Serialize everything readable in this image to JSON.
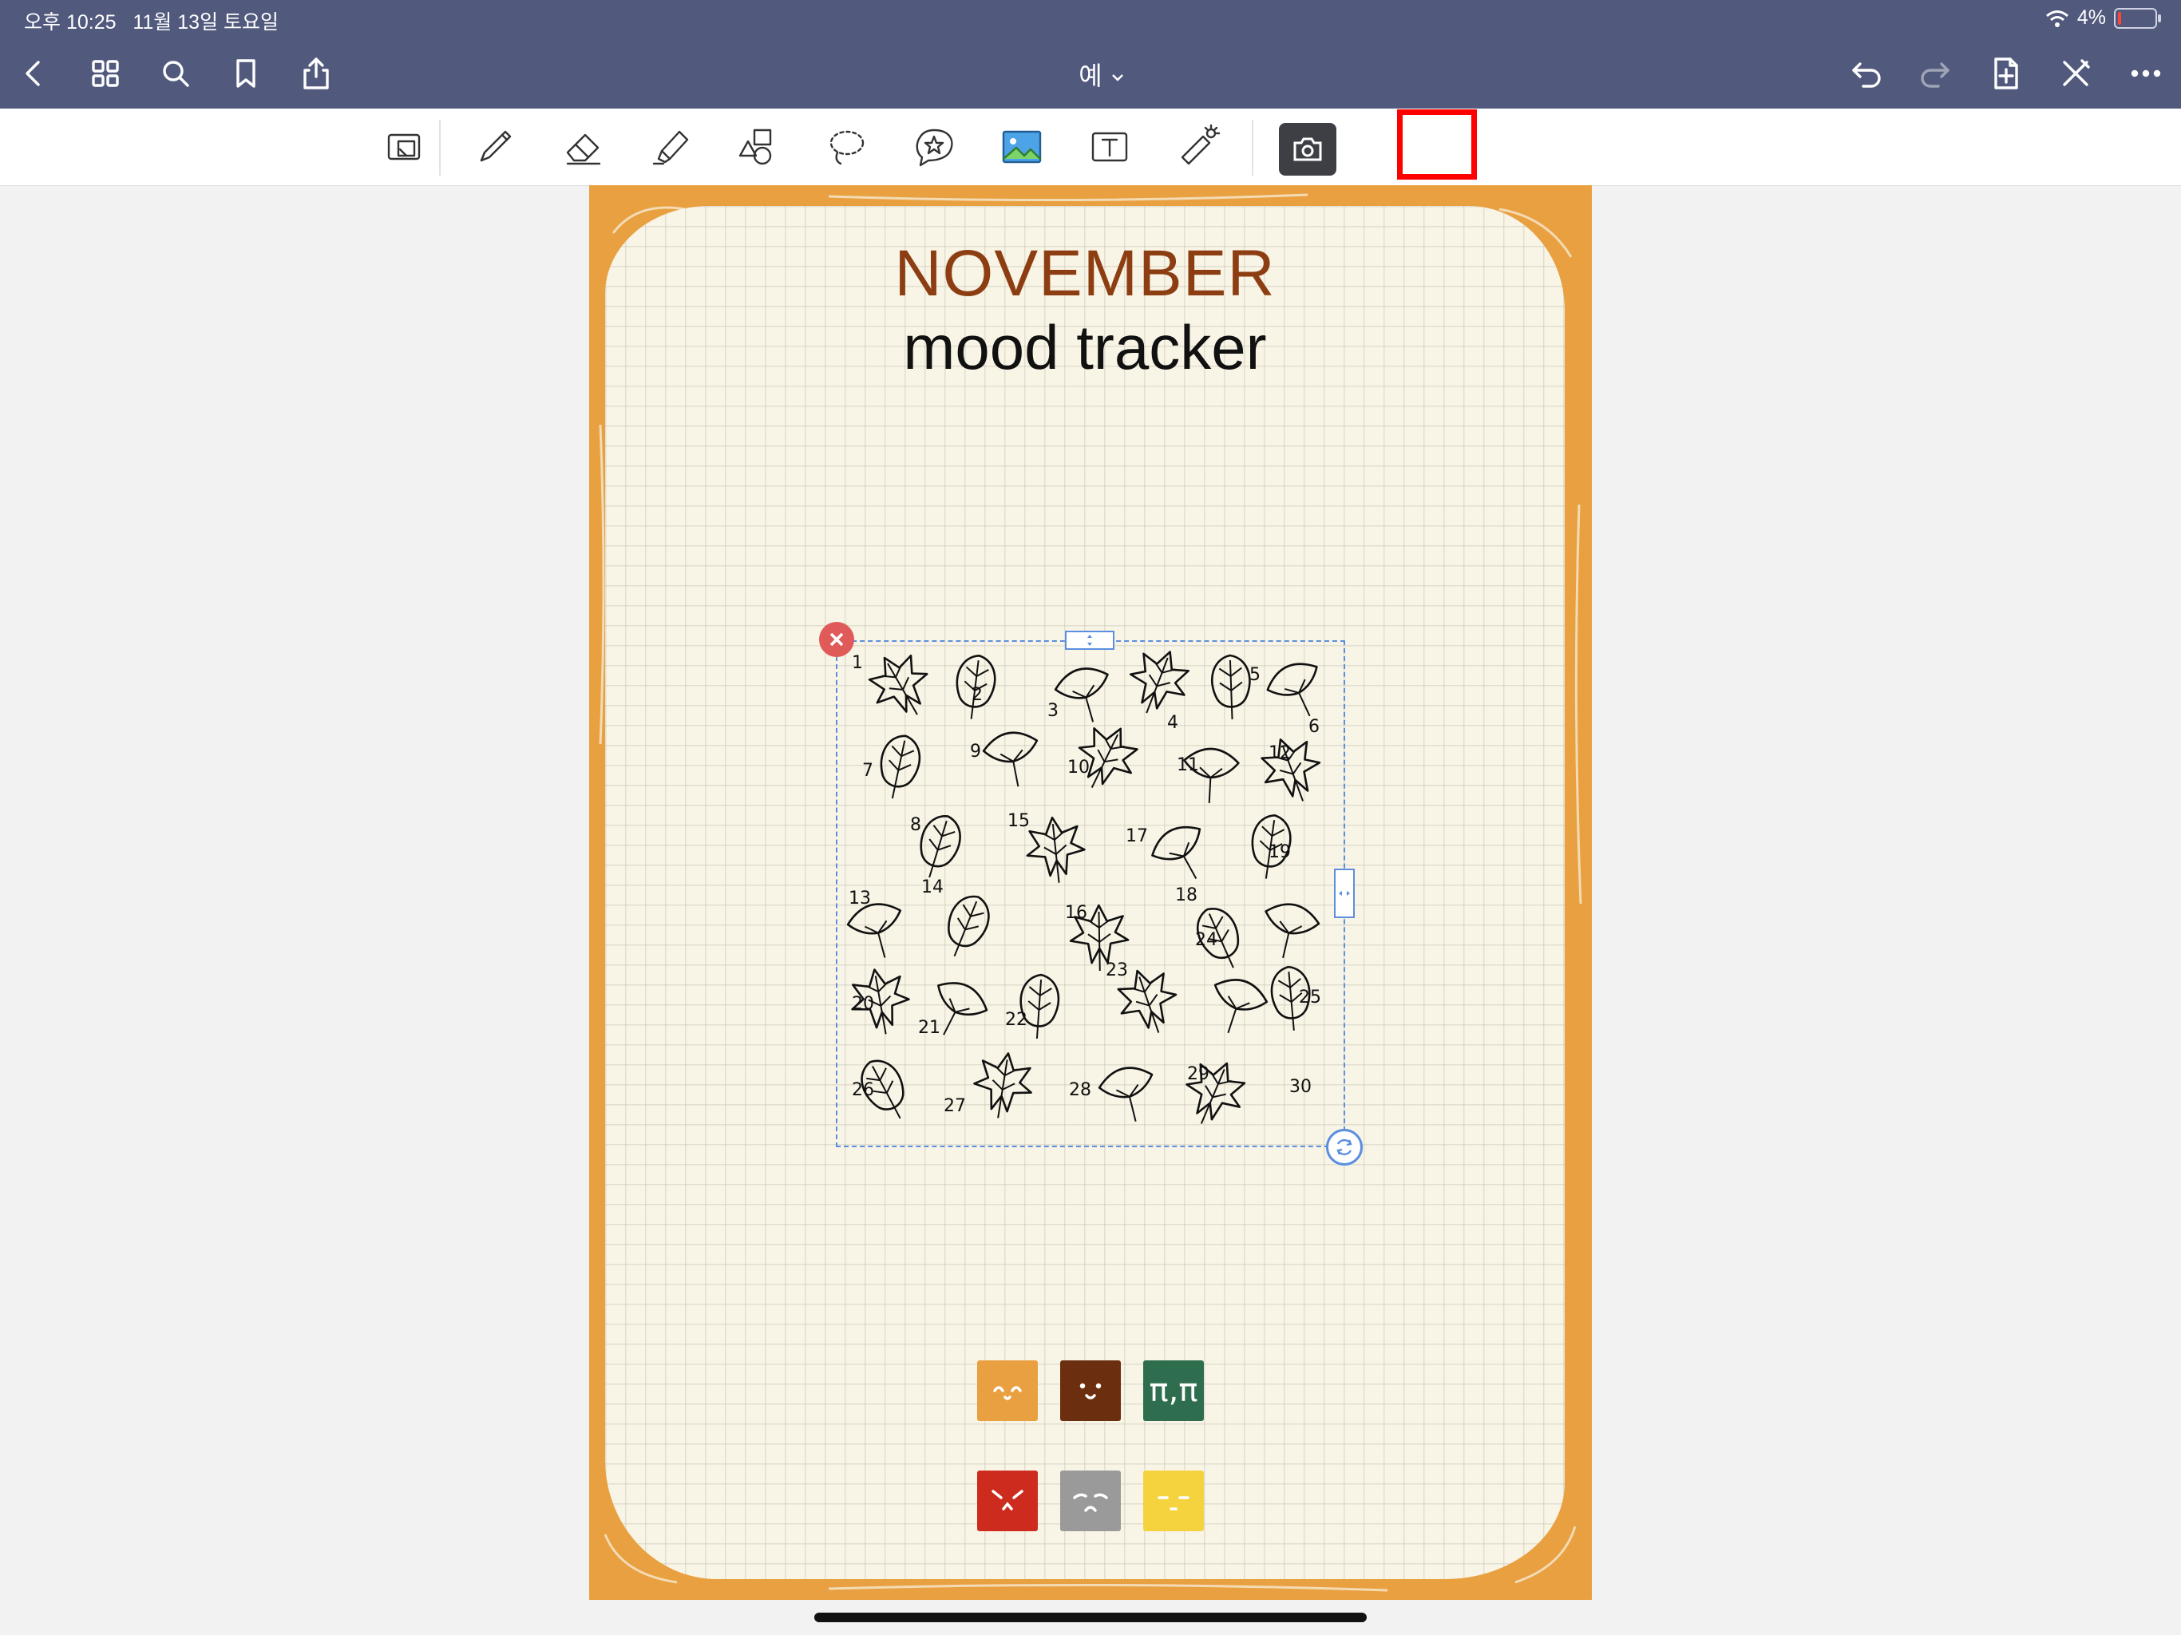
{
  "status_bar": {
    "time": "오후 10:25",
    "date": "11월 13일 토요일",
    "battery": "4%",
    "battery_level_fraction": 0.04
  },
  "nav": {
    "document_title": "예",
    "left_icons": [
      "back-icon",
      "grid-icon",
      "search-icon",
      "bookmark-icon",
      "share-icon"
    ],
    "right_icons": [
      "undo-icon",
      "redo-icon",
      "add-page-icon",
      "close-pen-icon",
      "more-icon"
    ]
  },
  "toolbar": {
    "tools": [
      "zoom-box-icon",
      "pen-icon",
      "eraser-icon",
      "highlighter-icon",
      "shapes-icon",
      "lasso-icon",
      "elements-icon",
      "image-icon",
      "text-icon",
      "laser-pointer-icon",
      "camera-icon"
    ],
    "stamp_thumbnails": [
      "leaf-stamp-thumbnail",
      "leaf-stamp-thumbnail"
    ]
  },
  "page": {
    "title_month": "NOVEMBER",
    "title_sub": "mood tracker",
    "leaf_numbers": [
      "1",
      "2",
      "3",
      "4",
      "5",
      "6",
      "7",
      "8",
      "9",
      "10",
      "11",
      "12",
      "13",
      "14",
      "15",
      "16",
      "17",
      "18",
      "19",
      "20",
      "21",
      "22",
      "23",
      "24",
      "25",
      "26",
      "27",
      "28",
      "29",
      "30"
    ],
    "mood_legend": [
      {
        "face": "happy",
        "text": "",
        "color": "#e9a040"
      },
      {
        "face": "calm",
        "text": "",
        "color": "#6b2e0e"
      },
      {
        "face": "crying",
        "text": "π,π",
        "color": "#2e6e4e"
      },
      {
        "face": "angry",
        "text": "",
        "color": "#cc2b1d"
      },
      {
        "face": "sad",
        "text": "",
        "color": "#9a9a9a"
      },
      {
        "face": "sleepy",
        "text": "",
        "color": "#f5d33f"
      }
    ]
  },
  "colors": {
    "app_bar": "#51597d",
    "frame": "#e9a040",
    "paper": "#f8f4e6",
    "title_month": "#8c3e12",
    "selection": "#5b8ee0",
    "highlight": "#ff0000"
  }
}
